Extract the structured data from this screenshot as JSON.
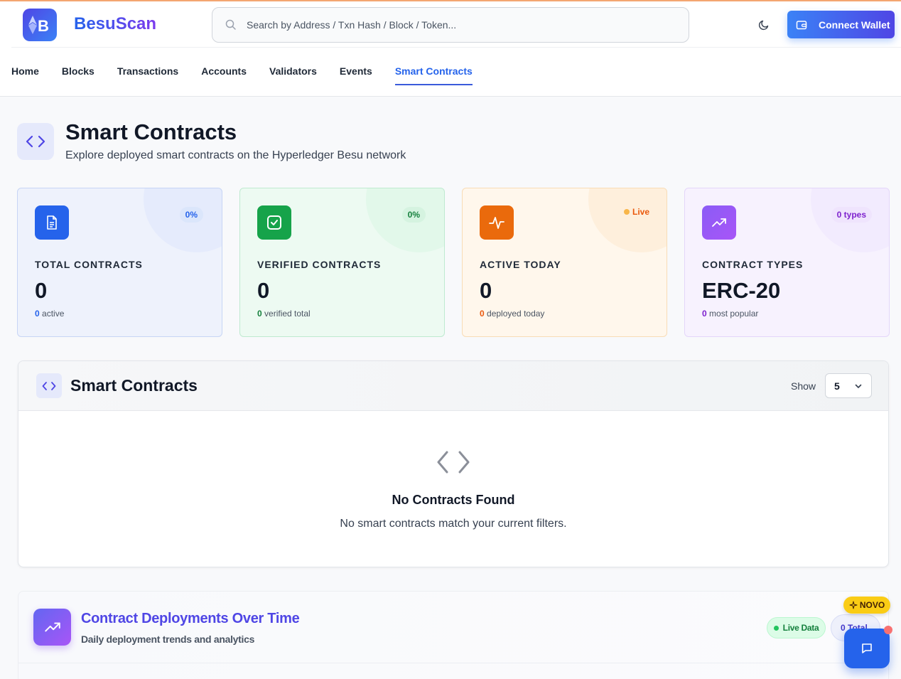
{
  "app": {
    "logo_letter": "B",
    "name": "BesuScan"
  },
  "search": {
    "placeholder": "Search by Address / Txn Hash / Block / Token..."
  },
  "header": {
    "connect_label": "Connect Wallet"
  },
  "nav": {
    "items": [
      {
        "label": "Home"
      },
      {
        "label": "Blocks"
      },
      {
        "label": "Transactions"
      },
      {
        "label": "Accounts"
      },
      {
        "label": "Validators"
      },
      {
        "label": "Events"
      },
      {
        "label": "Smart Contracts",
        "active": true
      }
    ]
  },
  "page": {
    "title": "Smart Contracts",
    "subtitle": "Explore deployed smart contracts on the Hyperledger Besu network"
  },
  "stats": [
    {
      "label": "TOTAL CONTRACTS",
      "value": "0",
      "badge": "0%",
      "foot_value": "0",
      "foot_text": " active",
      "icon": "document-icon",
      "color": "#2563eb"
    },
    {
      "label": "VERIFIED CONTRACTS",
      "value": "0",
      "badge": "0%",
      "foot_value": "0",
      "foot_text": " verified total",
      "icon": "check-square-icon",
      "color": "#16a34a"
    },
    {
      "label": "ACTIVE TODAY",
      "value": "0",
      "badge": "Live",
      "foot_value": "0",
      "foot_text": " deployed today",
      "icon": "activity-icon",
      "color": "#ea580c"
    },
    {
      "label": "CONTRACT TYPES",
      "value": "ERC-20",
      "badge": "0 types",
      "foot_value": "0",
      "foot_text": " most popular",
      "icon": "trending-up-icon",
      "color": "#7e22ce"
    }
  ],
  "contracts_panel": {
    "title": "Smart Contracts",
    "show_label": "Show",
    "show_value": "5",
    "empty_title": "No Contracts Found",
    "empty_subtitle": "No smart contracts match your current filters."
  },
  "deployments": {
    "title": "Contract Deployments Over Time",
    "subtitle": "Daily deployment trends and analytics",
    "live_label": "Live Data",
    "total_label": "0 Total",
    "new_badge": "NOVO"
  },
  "colors": {
    "accent": "#2563eb",
    "brand_purple": "#7c3aed"
  }
}
